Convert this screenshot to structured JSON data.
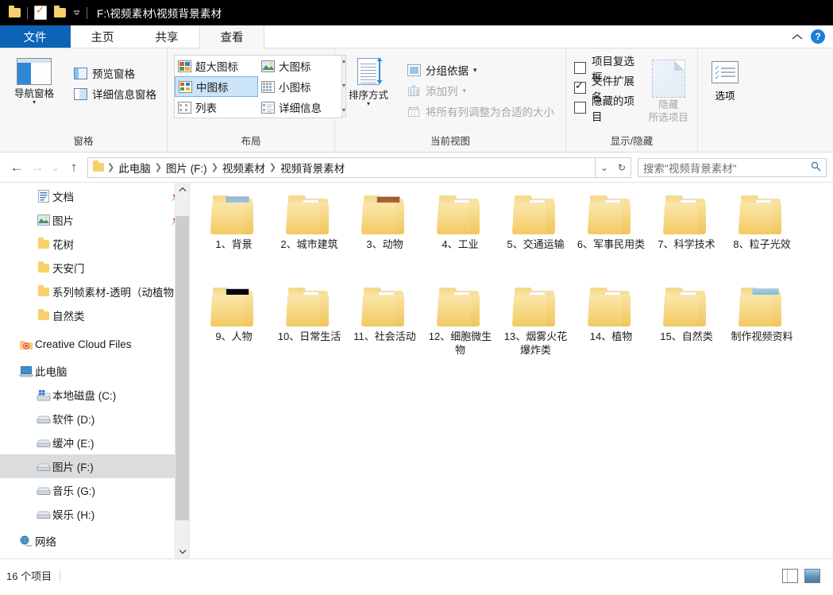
{
  "titlebar": {
    "path": "F:\\视频素材\\视频背景素材",
    "quick_access": [
      "folder-icon",
      "separator",
      "properties-icon",
      "new-folder-icon",
      "customize-caret"
    ]
  },
  "tabs": [
    {
      "label": "文件",
      "state": "file"
    },
    {
      "label": "主页",
      "state": "normal"
    },
    {
      "label": "共享",
      "state": "normal"
    },
    {
      "label": "查看",
      "state": "active"
    }
  ],
  "tab_right": {
    "collapse": "⌃",
    "help": "?"
  },
  "ribbon": {
    "groups": [
      {
        "label": "窗格",
        "big_button": {
          "label": "导航窗格",
          "caret": "▾"
        },
        "items": [
          {
            "label": "预览窗格",
            "dim": false
          },
          {
            "label": "详细信息窗格",
            "dim": false
          }
        ]
      },
      {
        "label": "布局",
        "gallery": [
          {
            "label": "超大图标",
            "selected": false
          },
          {
            "label": "大图标",
            "selected": false
          },
          {
            "label": "中图标",
            "selected": true
          },
          {
            "label": "小图标",
            "selected": false
          },
          {
            "label": "列表",
            "selected": false
          },
          {
            "label": "详细信息",
            "selected": false
          }
        ],
        "scroll": [
          "▴",
          "▾",
          "▾"
        ]
      },
      {
        "label": "当前视图",
        "big_button": {
          "label": "排序方式",
          "caret": "▾"
        },
        "items": [
          {
            "label": "分组依据",
            "dim": false,
            "caret": "▾"
          },
          {
            "label": "添加列",
            "dim": true,
            "caret": "▾"
          },
          {
            "label": "将所有列调整为合适的大小",
            "dim": true,
            "caret": ""
          }
        ]
      },
      {
        "label": "显示/隐藏",
        "checkboxes": [
          {
            "label": "项目复选框",
            "checked": false
          },
          {
            "label": "文件扩展名",
            "checked": true
          },
          {
            "label": "隐藏的项目",
            "checked": false
          }
        ],
        "hide_button": {
          "line1": "隐藏",
          "line2": "所选项目"
        }
      },
      {
        "label": "",
        "options_button": {
          "label": "选项"
        }
      }
    ]
  },
  "addressbar": {
    "back": "←",
    "forward": "→",
    "recent": "⌄",
    "up": "↑",
    "breadcrumbs": [
      "此电脑",
      "图片 (F:)",
      "视频素材",
      "视频背景素材"
    ],
    "dropdown": "⌄",
    "refresh": "↻"
  },
  "search": {
    "placeholder": "搜索\"视频背景素材\"",
    "icon": "search-icon"
  },
  "sidebar": {
    "items": [
      {
        "label": "文档",
        "icon": "document-icon",
        "indent": 2,
        "pinned": true,
        "selected": false
      },
      {
        "label": "图片",
        "icon": "pictures-icon",
        "indent": 2,
        "pinned": true,
        "selected": false
      },
      {
        "label": "花树",
        "icon": "folder-icon",
        "indent": 2,
        "pinned": false,
        "selected": false
      },
      {
        "label": "天安门",
        "icon": "folder-icon",
        "indent": 2,
        "pinned": false,
        "selected": false
      },
      {
        "label": "系列帧素材-透明（动植物）",
        "icon": "folder-icon",
        "indent": 2,
        "pinned": false,
        "selected": false
      },
      {
        "label": "自然类",
        "icon": "folder-icon",
        "indent": 2,
        "pinned": false,
        "selected": false
      },
      {
        "label": "Creative Cloud Files",
        "icon": "creative-cloud-icon",
        "indent": 1,
        "pinned": false,
        "selected": false
      },
      {
        "label": "此电脑",
        "icon": "this-pc-icon",
        "indent": 1,
        "pinned": false,
        "selected": false
      },
      {
        "label": "本地磁盘 (C:)",
        "icon": "system-drive-icon",
        "indent": 2,
        "pinned": false,
        "selected": false
      },
      {
        "label": "软件 (D:)",
        "icon": "drive-icon",
        "indent": 2,
        "pinned": false,
        "selected": false
      },
      {
        "label": "缓冲 (E:)",
        "icon": "drive-icon",
        "indent": 2,
        "pinned": false,
        "selected": false
      },
      {
        "label": "图片 (F:)",
        "icon": "drive-icon",
        "indent": 2,
        "pinned": false,
        "selected": true
      },
      {
        "label": "音乐 (G:)",
        "icon": "drive-icon",
        "indent": 2,
        "pinned": false,
        "selected": false
      },
      {
        "label": "娱乐 (H:)",
        "icon": "drive-icon",
        "indent": 2,
        "pinned": false,
        "selected": false
      },
      {
        "label": "网络",
        "icon": "network-icon",
        "indent": 1,
        "pinned": false,
        "selected": false
      }
    ],
    "scroll": {
      "up": "⌃",
      "down": "⌄"
    }
  },
  "files": [
    {
      "name": "1、背景",
      "thumb": "landscape"
    },
    {
      "name": "2、城市建筑",
      "thumb": "none"
    },
    {
      "name": "3、动物",
      "thumb": "cat"
    },
    {
      "name": "4、工业",
      "thumb": "none"
    },
    {
      "name": "5、交通运输",
      "thumb": "none"
    },
    {
      "name": "6、军事民用类",
      "thumb": "none"
    },
    {
      "name": "7、科学技术",
      "thumb": "none"
    },
    {
      "name": "8、粒子光效",
      "thumb": "none"
    },
    {
      "name": "9、人物",
      "thumb": "flower"
    },
    {
      "name": "10、日常生活",
      "thumb": "none"
    },
    {
      "name": "11、社会活动",
      "thumb": "none"
    },
    {
      "name": "12、细胞微生物",
      "thumb": "none"
    },
    {
      "name": "13、烟雾火花爆炸类",
      "thumb": "none"
    },
    {
      "name": "14、植物",
      "thumb": "none"
    },
    {
      "name": "15、自然类",
      "thumb": "none"
    },
    {
      "name": "制作视频资料",
      "thumb": "nature"
    }
  ],
  "statusbar": {
    "count": "16 个项目",
    "view_details": "details-view-icon",
    "view_icons": "large-icons-view-icon"
  },
  "colors": {
    "titlebar_bg": "#000000",
    "file_tab_bg": "#0c64b8",
    "ribbon_bg": "#f7f7f7",
    "selection_bg": "#cce4f7",
    "sidebar_selection_bg": "#dcdcdc",
    "folder_yellow": "#f4d179"
  }
}
